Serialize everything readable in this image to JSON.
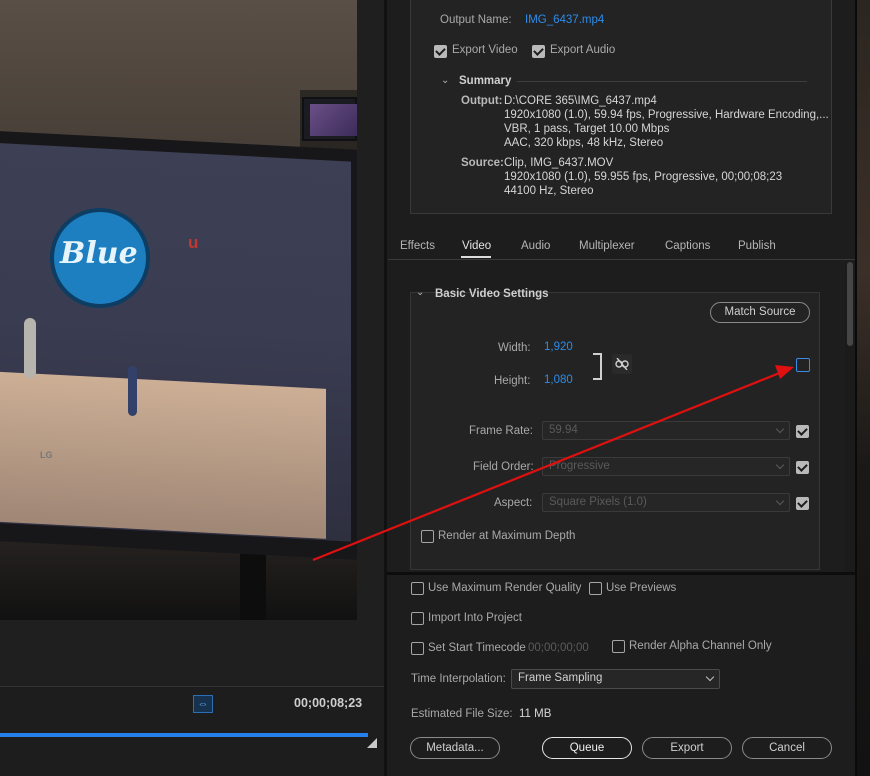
{
  "output": {
    "name_label": "Output Name:",
    "name_value": "IMG_6437.mp4",
    "export_video": "Export Video",
    "export_audio": "Export Audio"
  },
  "summary": {
    "heading": "Summary",
    "output_label": "Output:",
    "output_lines": [
      "D:\\CORE 365\\IMG_6437.mp4",
      "1920x1080 (1.0), 59.94 fps, Progressive, Hardware Encoding,...",
      "VBR, 1 pass, Target 10.00 Mbps",
      "AAC, 320 kbps, 48 kHz, Stereo"
    ],
    "source_label": "Source:",
    "source_lines": [
      "Clip, IMG_6437.MOV",
      "1920x1080 (1.0), 59.955 fps, Progressive, 00;00;08;23",
      "44100 Hz, Stereo"
    ]
  },
  "tabs": [
    "Effects",
    "Video",
    "Audio",
    "Multiplexer",
    "Captions",
    "Publish"
  ],
  "active_tab": "Video",
  "video": {
    "section_title": "Basic Video Settings",
    "match_source": "Match Source",
    "width_label": "Width:",
    "width_value": "1,920",
    "height_label": "Height:",
    "height_value": "1,080",
    "frame_rate_label": "Frame Rate:",
    "frame_rate_value": "59.94",
    "field_order_label": "Field Order:",
    "field_order_value": "Progressive",
    "aspect_label": "Aspect:",
    "aspect_value": "Square Pixels (1.0)",
    "render_max_depth": "Render at Maximum Depth"
  },
  "options": {
    "max_render_quality": "Use Maximum Render Quality",
    "use_previews": "Use Previews",
    "import_into_project": "Import Into Project",
    "set_start_timecode": "Set Start Timecode",
    "start_timecode_value": "00;00;00;00",
    "render_alpha": "Render Alpha Channel Only",
    "time_interp_label": "Time Interpolation:",
    "time_interp_value": "Frame Sampling",
    "file_size_label": "Estimated File Size:",
    "file_size_value": "11 MB"
  },
  "buttons": {
    "metadata": "Metadata...",
    "queue": "Queue",
    "export": "Export",
    "cancel": "Cancel"
  },
  "preview": {
    "timecode": "00;00;08;23",
    "playhead_progress": 1.0,
    "screen_logo": "Blue"
  },
  "colors": {
    "accent": "#2d8ceb",
    "arrow": "#e01010"
  }
}
